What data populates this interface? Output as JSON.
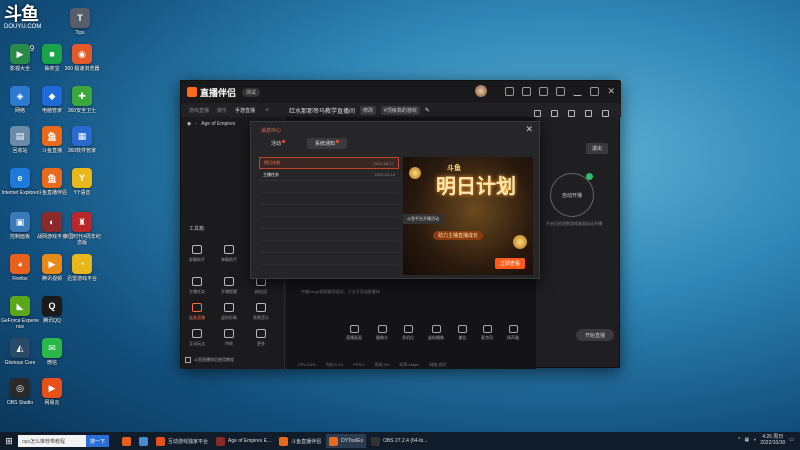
{
  "desktop": {
    "logo_text": "斗鱼",
    "logo_sub": "DOUYU.COM",
    "room_id": "56139",
    "icons": [
      {
        "label": "Tips",
        "color": "#555e6a",
        "glyph": "T"
      },
      {
        "label": "影视大全",
        "color": "#2a8a4a",
        "glyph": "▶"
      },
      {
        "label": "抽奖宝",
        "color": "#1aa34a",
        "glyph": "■"
      },
      {
        "label": "360 极速浏览器",
        "color": "#e35a2a",
        "glyph": "◉"
      },
      {
        "label": "网络",
        "color": "#2a7ad0",
        "glyph": "◈"
      },
      {
        "label": "电脑管家",
        "color": "#1e6ad8",
        "glyph": "◆"
      },
      {
        "label": "360安全卫士",
        "color": "#3aa83a",
        "glyph": "✚"
      },
      {
        "label": "回收站",
        "color": "#6a8aa8",
        "glyph": "▤"
      },
      {
        "label": "斗鱼直播",
        "color": "#e86a1a",
        "glyph": "鱼"
      },
      {
        "label": "360软件管家",
        "color": "#2a6ad0",
        "glyph": "▦"
      },
      {
        "label": "Internet Explorer",
        "color": "#1e7ad8",
        "glyph": "e"
      },
      {
        "label": "斗鱼直播伴侣",
        "color": "#e86a1a",
        "glyph": "鱼"
      },
      {
        "label": "YY语音",
        "color": "#e8b81a",
        "glyph": "Y"
      },
      {
        "label": "控制面板",
        "color": "#3a7ab8",
        "glyph": "▣"
      },
      {
        "label": "战网游戏平台",
        "color": "#8a2a2a",
        "glyph": "◐"
      },
      {
        "label": "帝国时代4周年纪念版",
        "color": "#b8282a",
        "glyph": "♜"
      },
      {
        "label": "Firefox",
        "color": "#e8601a",
        "glyph": "◕"
      },
      {
        "label": "腾讯视频",
        "color": "#e88a1a",
        "glyph": "▶"
      },
      {
        "label": "迅雷游戏平台",
        "color": "#e8b81a",
        "glyph": "◔"
      },
      {
        "label": "GeForce Experience",
        "color": "#5aa81a",
        "glyph": "◣"
      },
      {
        "label": "腾讯QQ",
        "color": "#1a1a1a",
        "glyph": "Q"
      },
      {
        "label": "Glorious Core",
        "color": "#2a4a6a",
        "glyph": "◭"
      },
      {
        "label": "微信",
        "color": "#2ab84a",
        "glyph": "✉"
      },
      {
        "label": "OBS Studio",
        "color": "#2a2a2a",
        "glyph": "◎"
      },
      {
        "label": "网易云",
        "color": "#e8501a",
        "glyph": "▶"
      }
    ]
  },
  "app": {
    "title": "直播伴侣",
    "version_badge": "测试",
    "tabs": [
      "游戏直播",
      "娱乐",
      "手游直播"
    ],
    "stream_title": "红水那那帝马教学直播间",
    "stream_edit": "修改",
    "category_chip": "#顶级高的游戏",
    "game_name": "Age of Empires",
    "tools_label": "工具箱",
    "tools": [
      {
        "label": "屏幕助手",
        "active": false
      },
      {
        "label": "弹幕助手",
        "active": false
      },
      {
        "label": "主播任务",
        "active": false
      },
      {
        "label": "开播提醒",
        "active": false
      },
      {
        "label": "粉丝团",
        "active": false
      },
      {
        "label": "连麦直播",
        "active": true
      },
      {
        "label": "虚拟形象",
        "active": false
      },
      {
        "label": "背景音乐",
        "active": false
      },
      {
        "label": "互动玩法",
        "active": false
      },
      {
        "label": "特效",
        "active": false
      },
      {
        "label": "更多",
        "active": false
      }
    ],
    "left_footer": "斗鱼直播伴侣使用教程",
    "hint_text": "中美Dmgt/视频美观测试，下方可添加直播间",
    "bottom_tools": [
      "直播画面",
      "摄像头",
      "多机位",
      "虚拟摄像",
      "美化",
      "麦克风",
      "扬声器"
    ],
    "start_button": "开始直播",
    "status": [
      "CPU:12%",
      "内存:9.1G",
      "FPS:0",
      "丢帧:0%",
      "码率:0kbps",
      "网络:良好"
    ],
    "exit_button": "退出",
    "ring_label": "自动开播",
    "ring_caption": "开启后检测到游戏画面自动开播"
  },
  "modal": {
    "title": "消息中心",
    "tabs": [
      {
        "label": "活动",
        "selected": false
      },
      {
        "label": "系统通知",
        "selected": true
      }
    ],
    "items": [
      {
        "title": "明日计划",
        "date": "2022-08-17",
        "selected": true
      },
      {
        "title": "主播任务",
        "date": "2022-03-18",
        "selected": false
      }
    ],
    "promo": {
      "logo": "斗鱼",
      "headline": "明日计划",
      "subline": "助力主播直播成长",
      "tooltip": "斗鱼平台开播活动",
      "button": "立即查看"
    }
  },
  "taskbar": {
    "search_placeholder": "ops怎么推荐带教程",
    "search_button": "搜一下",
    "apps": [
      {
        "label": "",
        "color": "#e8601a",
        "active": false
      },
      {
        "label": "",
        "color": "#4a8ad0",
        "active": false
      },
      {
        "label": "互动游戏独家平台",
        "color": "#e8501a",
        "active": false
      },
      {
        "label": "Age of Empires E...",
        "color": "#8a2a2a",
        "active": false
      },
      {
        "label": "斗鱼直播伴侣",
        "color": "#e86a1a",
        "active": false
      },
      {
        "label": "DYToolEx",
        "color": "#e86a1a",
        "active": true
      },
      {
        "label": "OBS 27.2.4 (64-bi...",
        "color": "#333333",
        "active": false
      }
    ],
    "time": "4:26 周日",
    "date": "2022/10/30"
  }
}
